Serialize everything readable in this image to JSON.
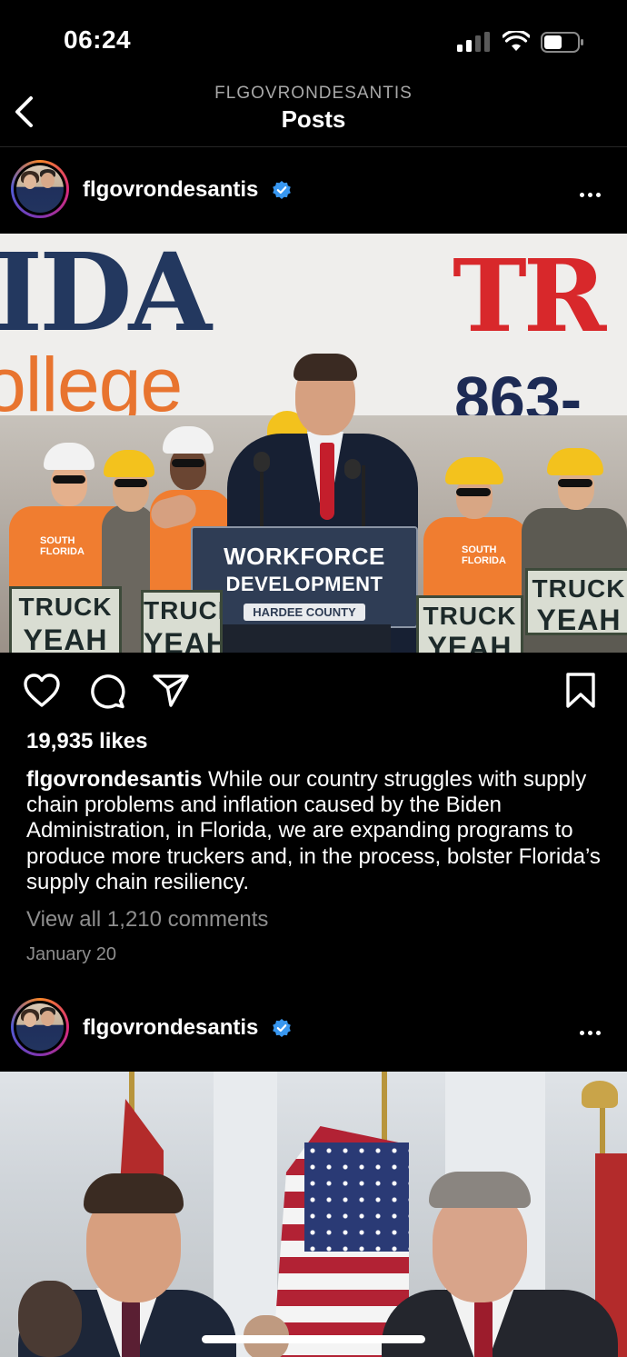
{
  "status_bar": {
    "time": "06:24"
  },
  "nav": {
    "account": "FLGOVRONDESANTIS",
    "title": "Posts"
  },
  "posts": [
    {
      "username": "flgovrondesantis",
      "photo_text": {
        "banner_left": "IDA",
        "banner_sub": "ollege",
        "banner_right": "TR",
        "phone": "863-",
        "podium_line1": "WORKFORCE",
        "podium_line2": "DEVELOPMENT",
        "podium_line3": "HARDEE COUNTY",
        "sign_truck": "TRUCK",
        "sign_yeah": "YEAH",
        "shirt_text": "SOUTH FLORIDA"
      },
      "likes": "19,935 likes",
      "caption_user": "flgovrondesantis",
      "caption_text": "While our country struggles with supply chain problems and inflation caused by the Biden Administration, in Florida, we are expanding programs to produce more truckers and, in the process, bolster Florida’s supply chain resiliency.",
      "comments_link": "View all 1,210 comments",
      "date": "January 20"
    },
    {
      "username": "flgovrondesantis"
    }
  ],
  "icons": {
    "back": "chevron-left-icon",
    "verified": "verified-badge-icon",
    "more": "more-options-icon",
    "like": "heart-icon",
    "comment": "comment-icon",
    "share": "paper-plane-icon",
    "save": "bookmark-icon"
  },
  "colors": {
    "background": "#000000",
    "verified": "#3897f0",
    "secondary_text": "#8e8e8e"
  }
}
